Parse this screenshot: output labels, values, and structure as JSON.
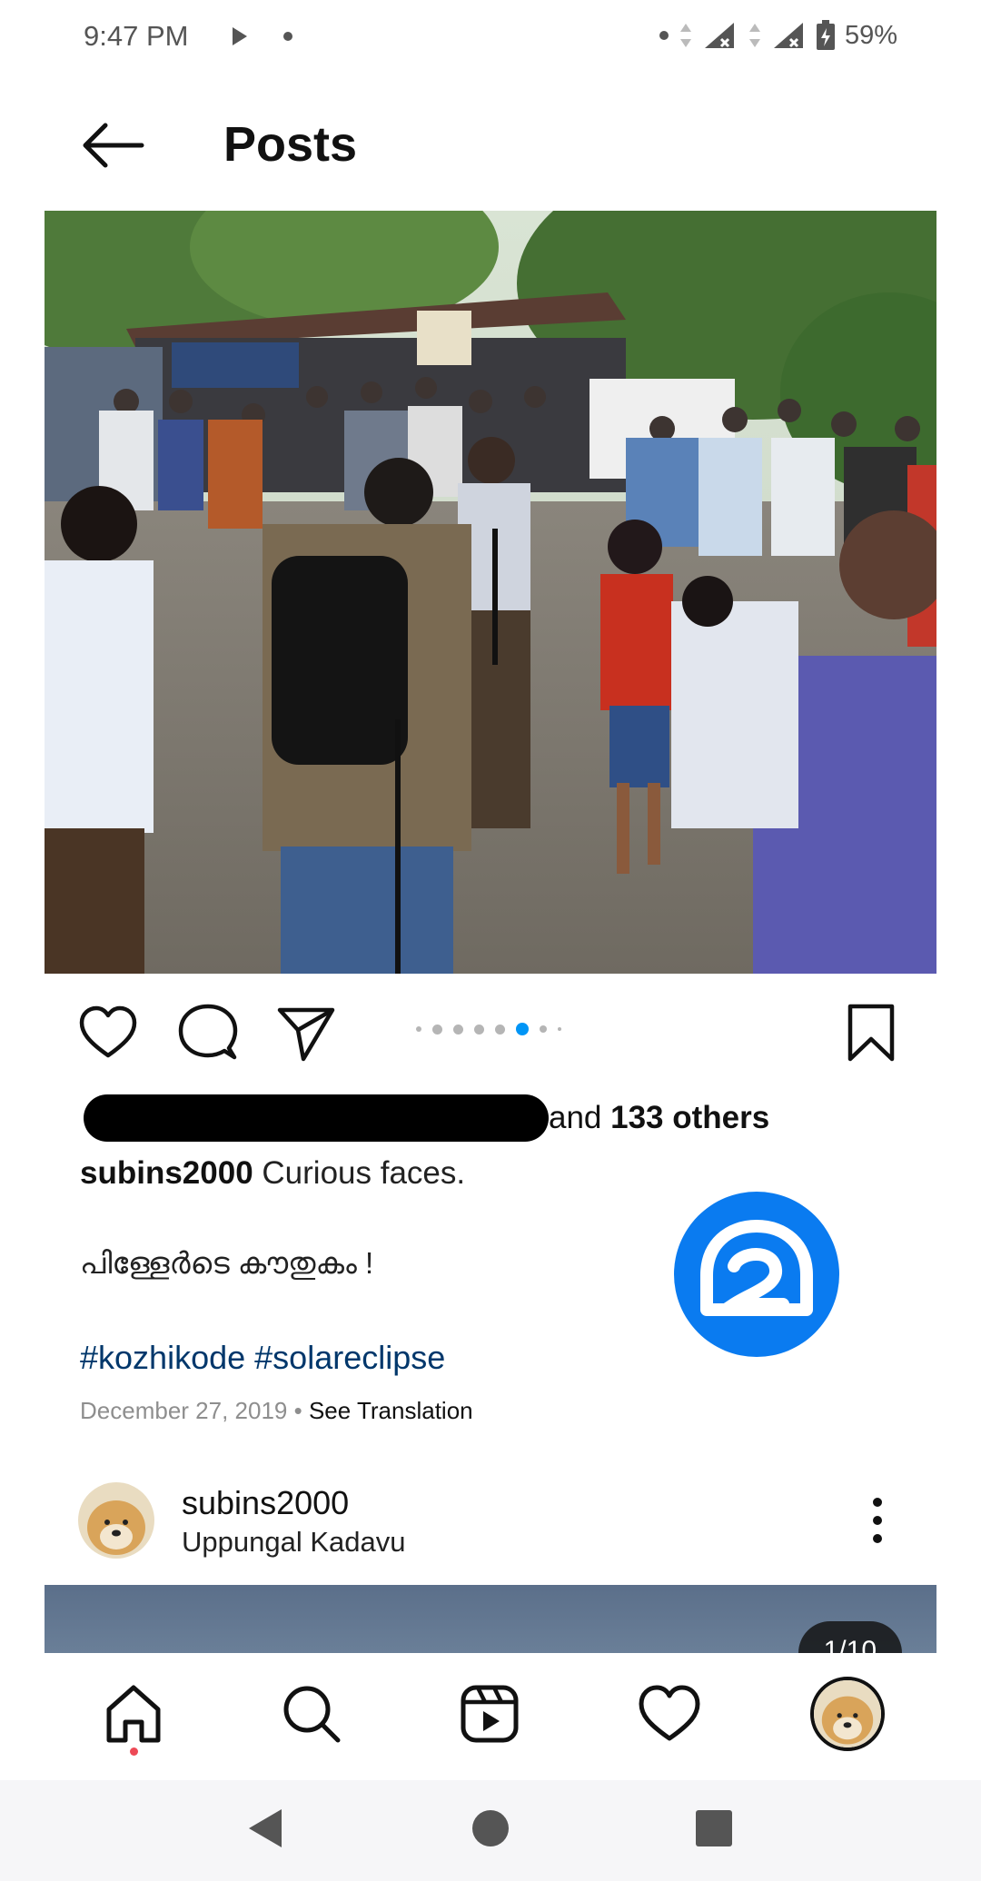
{
  "status_bar": {
    "time": "9:47 PM",
    "battery": "59%"
  },
  "header": {
    "title": "Posts"
  },
  "post": {
    "carousel": {
      "total_dots": 8,
      "active_index": 5
    },
    "likes": {
      "text_prefix": "and ",
      "count_text": "133 others"
    },
    "caption": {
      "username": "subins2000",
      "text": "Curious faces.",
      "malayalam": "പിള്ളേർടെ കൗതുകം !",
      "hashtags": [
        "#kozhikode",
        "#solareclipse"
      ]
    },
    "date": "December 27, 2019",
    "separator": "•",
    "see_translation": "See Translation"
  },
  "next_post": {
    "username": "subins2000",
    "location": "Uppungal Kadavu",
    "page_counter": "1/10"
  },
  "colors": {
    "accent_blue": "#0095f6",
    "hashtag": "#00376b",
    "watermark": "#0a7bf0",
    "notification_dot": "#ed4956"
  },
  "icons": {
    "back": "arrow-left-icon",
    "like": "heart-icon",
    "comment": "comment-bubble-icon",
    "share": "paper-plane-icon",
    "save": "bookmark-icon",
    "more": "vertical-dots-icon",
    "nav": [
      "home-icon",
      "search-icon",
      "reels-icon",
      "heart-icon",
      "profile-avatar"
    ]
  }
}
